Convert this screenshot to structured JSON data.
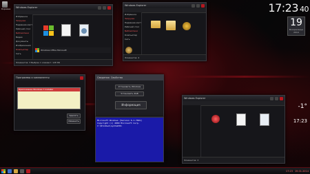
{
  "desktop": {
    "recycle_label": "Корзина"
  },
  "clock": {
    "time": "17:23",
    "seconds": "40",
    "date": "19",
    "weekday": "Воскресенье 2014"
  },
  "win_explorer_left": {
    "title": "Windows Explorer",
    "status": "Элементов: 3   Выбран 1 элемент: 128 КБ",
    "file_label": "Windows Office Microsoft",
    "sidebar": [
      "Избранное",
      "Загрузки",
      "Недавние места",
      "Рабочий стол",
      "Библиотеки",
      "Видео",
      "Документы",
      "Изображения",
      "Компьютер",
      "Сеть"
    ]
  },
  "win_explorer_right": {
    "title": "Windows Explorer",
    "status": "Элементов: 4",
    "sidebar": [
      "Избранное",
      "Загрузки",
      "Недавние места",
      "Рабочий стол",
      "Библиотеки",
      "Компьютер",
      "Сеть"
    ]
  },
  "win_dialog_left": {
    "title": "Программы и компоненты",
    "row_label": "Приложение Windows 7 Installer",
    "btn1": "Удалить",
    "btn2": "Изменить"
  },
  "win_dialog_center": {
    "tab1": "Сведения",
    "tab2": "Свойства",
    "opt1": "Установить Windows",
    "opt2": "Установить 4GB",
    "info_btn": "Информация"
  },
  "win_console": {
    "line1": "Microsoft Windows [Version 6.1.7601]",
    "line2": "Copyright (c) 2009 Microsoft Corp.",
    "line3": "C:\\Windows\\system32>"
  },
  "win_explorer_bottom": {
    "title": "Windows Explorer",
    "status": "Элементов: 3"
  },
  "side_clock": {
    "time": "17:23",
    "temp": "-1°"
  },
  "tray": {
    "time": "17:23",
    "date": "19.01.2014"
  }
}
